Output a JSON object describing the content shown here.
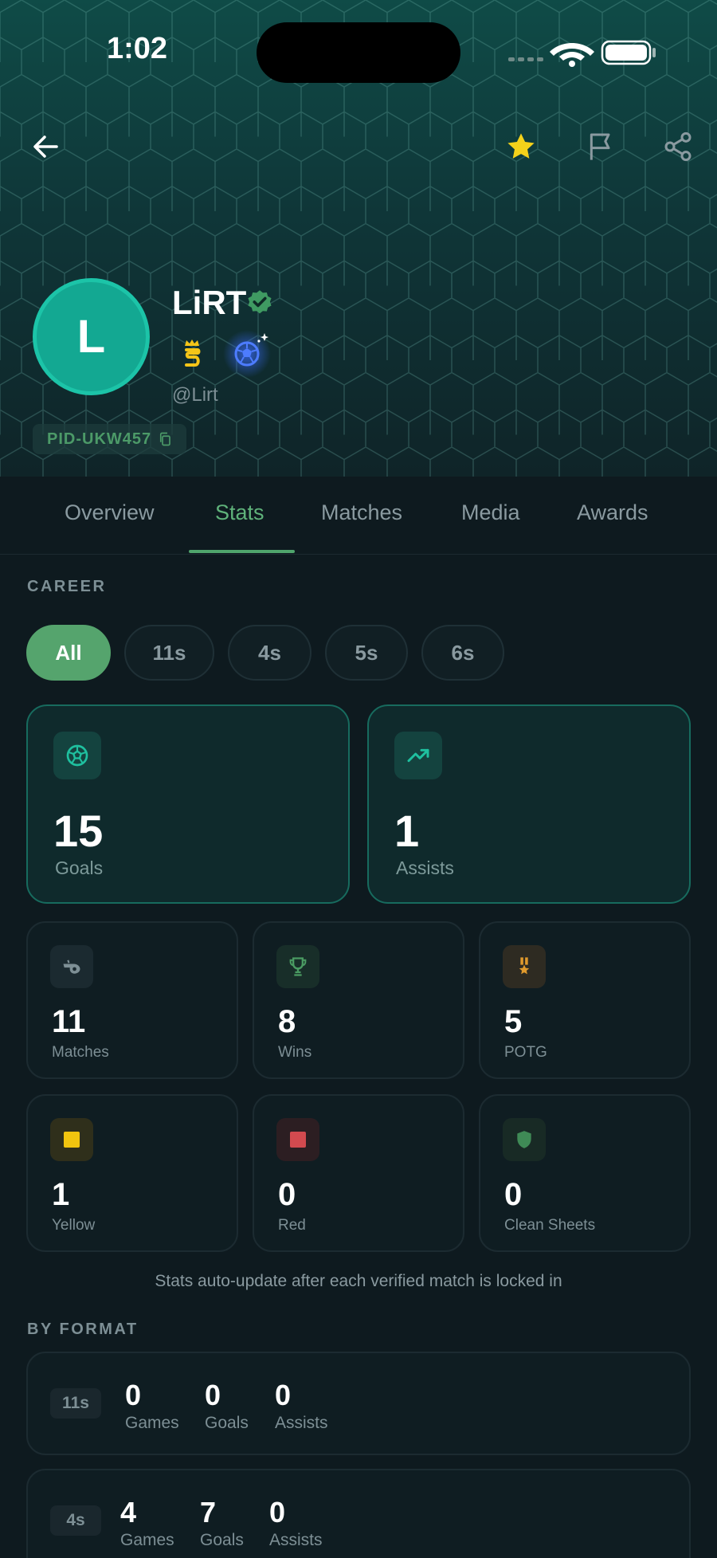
{
  "status_bar": {
    "time": "1:02"
  },
  "profile": {
    "avatar_letter": "L",
    "name": "LiRT",
    "handle": "@Lirt",
    "pid": "PID-UKW457"
  },
  "tabs": [
    "Overview",
    "Stats",
    "Matches",
    "Media",
    "Awards"
  ],
  "active_tab": "Stats",
  "career": {
    "section_label": "CAREER",
    "filters": [
      "All",
      "11s",
      "4s",
      "5s",
      "6s"
    ],
    "active_filter": "All",
    "highlights": [
      {
        "icon": "soccer-ball-icon",
        "value": "15",
        "label": "Goals"
      },
      {
        "icon": "trending-up-icon",
        "value": "1",
        "label": "Assists"
      }
    ],
    "stats": [
      {
        "icon": "whistle-icon",
        "value": "11",
        "label": "Matches"
      },
      {
        "icon": "trophy-icon",
        "value": "8",
        "label": "Wins"
      },
      {
        "icon": "medal-icon",
        "value": "5",
        "label": "POTG"
      },
      {
        "icon": "yellow-card-icon",
        "value": "1",
        "label": "Yellow"
      },
      {
        "icon": "red-card-icon",
        "value": "0",
        "label": "Red"
      },
      {
        "icon": "shield-icon",
        "value": "0",
        "label": "Clean Sheets"
      }
    ],
    "note": "Stats auto-update after each verified match is locked in"
  },
  "by_format": {
    "section_label": "BY FORMAT",
    "rows": [
      {
        "format": "11s",
        "games": "0",
        "goals": "0",
        "assists": "0",
        "games_label": "Games",
        "goals_label": "Goals",
        "assists_label": "Assists"
      },
      {
        "format": "4s",
        "games": "4",
        "goals": "7",
        "assists": "0",
        "games_label": "Games",
        "goals_label": "Goals",
        "assists_label": "Assists"
      }
    ]
  },
  "colors": {
    "accent_green": "#55a46d",
    "teal": "#13a892",
    "yellow_card": "#f1c40f",
    "red_card": "#d24a4f"
  }
}
